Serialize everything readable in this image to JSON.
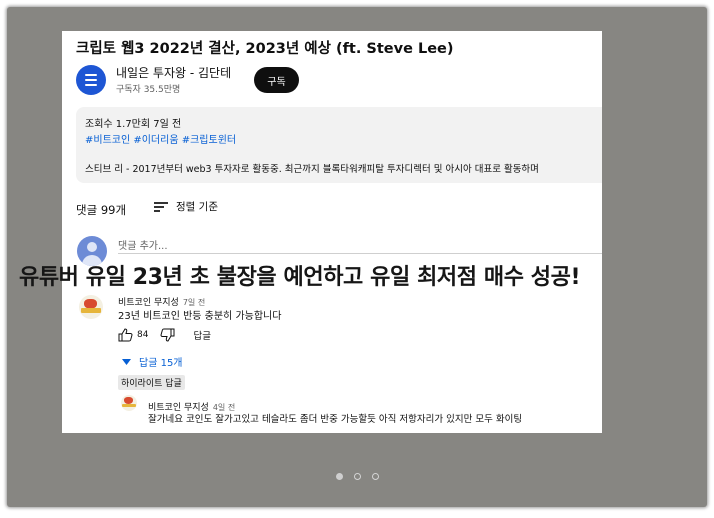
{
  "video": {
    "title": "크립토 웹3 2022년 결산, 2023년 예상 (ft. Steve Lee)",
    "channel_name": "내일은 투자왕 - 김단테",
    "subscribers": "구독자 35.5만명",
    "subscribe_label": "구독"
  },
  "description": {
    "meta": "조회수 1.7만회 7일 전",
    "hashtags": "#비트코인 #이더리움 #크립토윈터",
    "text": "스티브 리 - 2017년부터 web3 투자자로 활동중. 최근까지 블록타워캐피탈 투자디렉터 및 아시아 대표로 활동하며"
  },
  "comments_header": {
    "count": "댓글 99개",
    "sort_label": "정렬 기준"
  },
  "add_comment": {
    "placeholder": "댓글 추가..."
  },
  "caption": "유튜버 유일 23년 초 불장을 예언하고 유일 최저점 매수 성공!",
  "top_comment": {
    "author": "비트코인 무지성",
    "time": "7일 전",
    "text": "23년 비트코인 반등 충분히 가능합니다",
    "likes": "84",
    "reply_label": "답글",
    "replies_toggle": "답글 15개"
  },
  "highlight_label": "하이라이트 답글",
  "reply": {
    "author": "비트코인 무지성",
    "time": "4일 전",
    "text": "잘가네요 코인도 잘가고있고 테슬라도 좀더 반중 가능할듯 아직 저항자리가 있지만 모두 화이팅"
  },
  "carousel": {
    "total_slides": 3,
    "active_index": 0
  },
  "colors": {
    "frame_background": "#878682",
    "link_blue": "#065fd4",
    "channel_avatar": "#1e56d4"
  }
}
